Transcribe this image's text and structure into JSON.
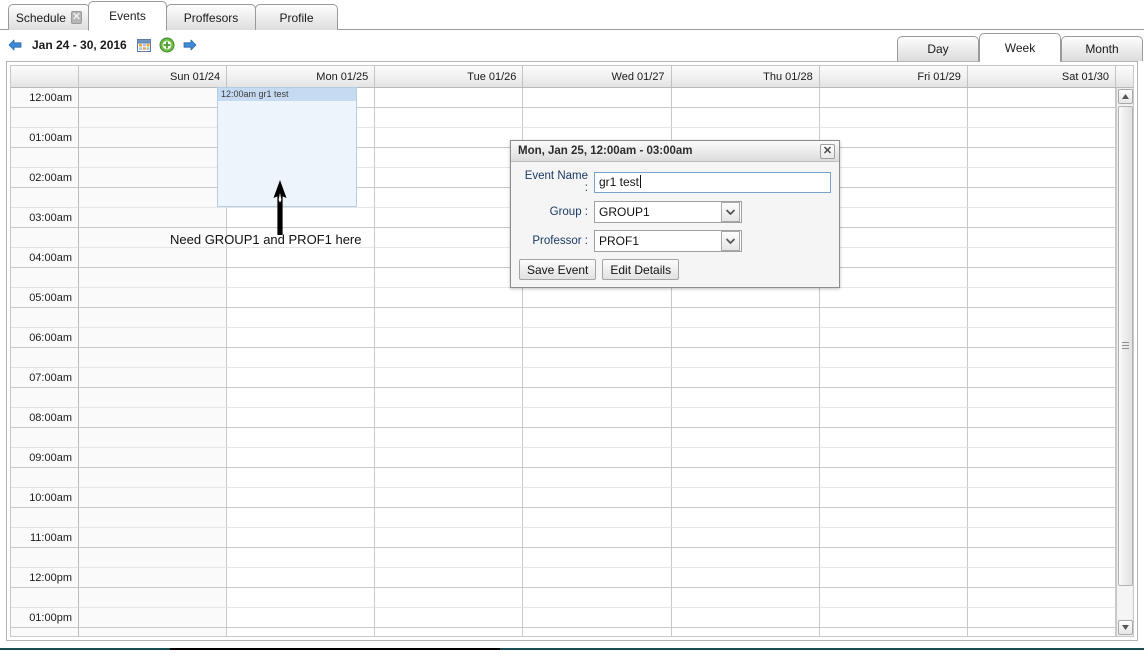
{
  "tabs": [
    {
      "label": "Schedule",
      "closable": true,
      "active": false,
      "close_icon": "close-icon"
    },
    {
      "label": "Events",
      "closable": false,
      "active": true
    },
    {
      "label": "Proffesors",
      "closable": false,
      "active": false
    },
    {
      "label": "Profile",
      "closable": false,
      "active": false
    }
  ],
  "toolbar": {
    "prev_icon": "arrow-left-icon",
    "date_range": "Jan 24 - 30, 2016",
    "calendar_icon": "calendar-icon",
    "add_icon": "add-circle-icon",
    "next_icon": "arrow-right-icon"
  },
  "view_switch": {
    "options": [
      "Day",
      "Week",
      "Month"
    ],
    "selected": "Week"
  },
  "calendar": {
    "gutter_header": "",
    "days": [
      "Sun 01/24",
      "Mon 01/25",
      "Tue 01/26",
      "Wed 01/27",
      "Thu 01/28",
      "Fri 01/29",
      "Sat 01/30"
    ],
    "times": [
      "12:00am",
      "01:00am",
      "02:00am",
      "03:00am",
      "04:00am",
      "05:00am",
      "06:00am",
      "07:00am",
      "08:00am",
      "09:00am",
      "10:00am",
      "11:00am",
      "12:00pm",
      "01:00pm"
    ],
    "event": {
      "title": "12:00am gr1 test",
      "day": "Mon 01/25",
      "start": "12:00am",
      "end": "03:00am",
      "bg_color": "#edf4fc",
      "header_color": "#c6dbf2"
    },
    "scrollbar": {
      "up_icon": "scroll-up-icon",
      "down_icon": "scroll-down-icon",
      "grip_icon": "grip-icon"
    }
  },
  "annotation": {
    "arrow_icon": "up-arrow-annotation-icon",
    "text": "Need GROUP1 and PROF1 here"
  },
  "dialog": {
    "title": "Mon, Jan 25, 12:00am - 03:00am",
    "close_icon": "close-icon",
    "fields": {
      "event_name_label": "Event Name :",
      "event_name_value": "gr1 test",
      "event_name_placeholder": "",
      "group_label": "Group :",
      "group_value": "GROUP1",
      "group_arrow_icon": "chevron-down-icon",
      "professor_label": "Professor :",
      "professor_value": "PROF1",
      "professor_arrow_icon": "chevron-down-icon"
    },
    "buttons": {
      "save": "Save Event",
      "edit": "Edit Details"
    }
  },
  "colors": {
    "accent_blue": "#1b3a63",
    "event_bg": "#edf4fc",
    "event_header": "#c6dbf2",
    "grid_line": "#c9c9c9",
    "bottom_rule": "#1b4b52"
  }
}
